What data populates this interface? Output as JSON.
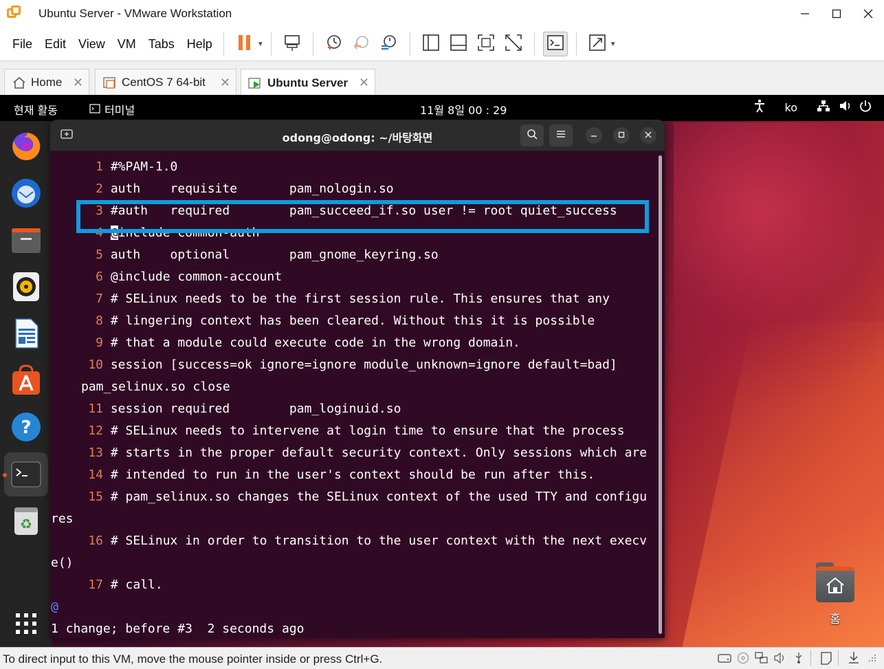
{
  "window": {
    "title": "Ubuntu Server - VMware Workstation"
  },
  "menu": {
    "items": [
      "File",
      "Edit",
      "View",
      "VM",
      "Tabs",
      "Help"
    ]
  },
  "tabs": [
    {
      "label": "Home"
    },
    {
      "label": "CentOS 7 64-bit"
    },
    {
      "label": "Ubuntu Server"
    }
  ],
  "gnome": {
    "activities": "현재 활동",
    "app_name": "터미널",
    "clock": "11월 8일  00 : 29",
    "input_method": "ko"
  },
  "terminal": {
    "title": "odong@odong: ~/바탕화면",
    "lines": [
      {
        "num": "1",
        "text": "#%PAM-1.0"
      },
      {
        "num": "2",
        "text": "auth    requisite       pam_nologin.so"
      },
      {
        "num": "3",
        "text": "#auth   required        pam_succeed_if.so user != root quiet_success"
      },
      {
        "num": "4",
        "text": "include common-auth",
        "cursor_char": "@"
      },
      {
        "num": "5",
        "text": "auth    optional        pam_gnome_keyring.so"
      },
      {
        "num": "6",
        "text": "@include common-account"
      },
      {
        "num": "7",
        "text": "# SELinux needs to be the first session rule. This ensures that any"
      },
      {
        "num": "8",
        "text": "# lingering context has been cleared. Without this it is possible"
      },
      {
        "num": "9",
        "text": "# that a module could execute code in the wrong domain."
      },
      {
        "num": "10",
        "text": "session [success=ok ignore=ignore module_unknown=ignore default=bad]"
      },
      {
        "num": "",
        "text": "pam_selinux.so close"
      },
      {
        "num": "11",
        "text": "session required        pam_loginuid.so"
      },
      {
        "num": "12",
        "text": "# SELinux needs to intervene at login time to ensure that the process"
      },
      {
        "num": "13",
        "text": "# starts in the proper default security context. Only sessions which are"
      },
      {
        "num": "14",
        "text": "# intended to run in the user's context should be run after this."
      },
      {
        "num": "15",
        "text": "# pam_selinux.so changes the SELinux context of the used TTY and configu"
      },
      {
        "num": "",
        "text": "res"
      },
      {
        "num": "16",
        "text": "# SELinux in order to transition to the user context with the next execv"
      },
      {
        "num": "",
        "text": "e()"
      },
      {
        "num": "17",
        "text": "# call."
      }
    ],
    "filler": "@",
    "status_line": "1 change; before #3  2 seconds ago"
  },
  "desktop": {
    "home_label": "홈"
  },
  "statusbar": {
    "text": "To direct input to this VM, move the mouse pointer inside or press Ctrl+G."
  },
  "colors": {
    "terminal_bg": "#300a24",
    "highlight_box": "#0f9be0",
    "line_numbers": "#ef8a5c",
    "accent_orange": "#e95420"
  }
}
